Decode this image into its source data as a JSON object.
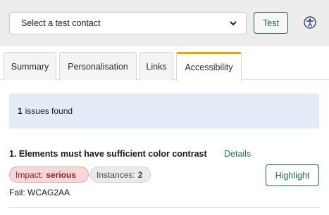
{
  "toolbar": {
    "contact_select": {
      "value": "Select a test contact"
    },
    "test_label": "Test",
    "accessibility_icon": "accessibility-icon"
  },
  "tabs": [
    {
      "label": "Summary",
      "active": false
    },
    {
      "label": "Personalisation",
      "active": false
    },
    {
      "label": "Links",
      "active": false
    },
    {
      "label": "Accessibility",
      "active": true
    }
  ],
  "summary": {
    "count": "1",
    "text": "issues found"
  },
  "issues": [
    {
      "title": "1. Elements must have sufficient color contrast",
      "details_label": "Details",
      "impact_label": "Impact:",
      "impact_value": "serious",
      "instances_label": "Instances:",
      "instances_value": "2",
      "highlight_label": "Highlight",
      "fail_text": "Fail: WCAG2AA"
    }
  ],
  "colors": {
    "accent_green": "#1f6b48",
    "active_tab_border": "#e8a600",
    "impact_bg": "#f8d7d7",
    "summary_bg": "#e4edf7"
  }
}
